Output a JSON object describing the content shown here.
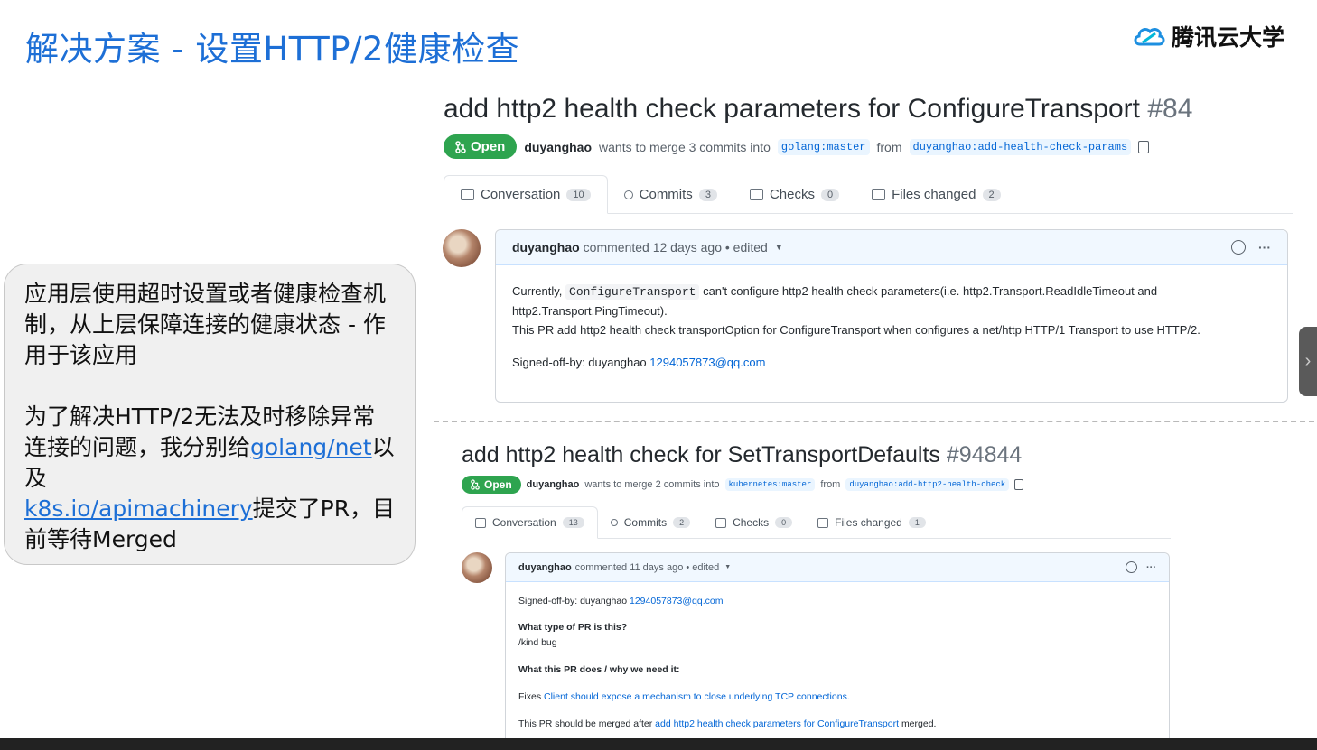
{
  "slide": {
    "title": "解决方案 - 设置HTTP/2健康检查",
    "brand": "腾讯云大学"
  },
  "note": {
    "para1": "应用层使用超时设置或者健康检查机制，从上层保障连接的健康状态 - 作用于该应用",
    "para2_prefix": "为了解决HTTP/2无法及时移除异常连接的问题，我分别给",
    "link1": "golang/net",
    "middle": "以及",
    "link2": "k8s.io/apimachinery",
    "para2_suffix": "提交了PR，目前等待Merged"
  },
  "pr1": {
    "title": "add http2 health check parameters for ConfigureTransport",
    "number": "#84",
    "state": "Open",
    "author": "duyanghao",
    "merge_text": "wants to merge 3 commits into",
    "base": "golang:master",
    "from": "from",
    "head": "duyanghao:add-health-check-params",
    "tabs": [
      {
        "label": "Conversation",
        "count": "10"
      },
      {
        "label": "Commits",
        "count": "3"
      },
      {
        "label": "Checks",
        "count": "0"
      },
      {
        "label": "Files changed",
        "count": "2"
      }
    ],
    "comment": {
      "author": "duyanghao",
      "meta": "commented 12 days ago • edited",
      "line1_prefix": "Currently,",
      "line1_code": "ConfigureTransport",
      "line1_suffix": "can't configure http2 health check parameters(i.e. http2.Transport.ReadIdleTimeout and http2.Transport.PingTimeout).",
      "line2": "This PR add http2 health check transportOption for ConfigureTransport when configures a net/http HTTP/1 Transport to use HTTP/2.",
      "signoff_prefix": "Signed-off-by: duyanghao",
      "signoff_email": "1294057873@qq.com"
    }
  },
  "pr2": {
    "title": "add http2 health check for SetTransportDefaults",
    "number": "#94844",
    "state": "Open",
    "author": "duyanghao",
    "merge_text": "wants to merge 2 commits into",
    "base": "kubernetes:master",
    "from": "from",
    "head": "duyanghao:add-http2-health-check",
    "tabs": [
      {
        "label": "Conversation",
        "count": "13"
      },
      {
        "label": "Commits",
        "count": "2"
      },
      {
        "label": "Checks",
        "count": "0"
      },
      {
        "label": "Files changed",
        "count": "1"
      }
    ],
    "comment": {
      "author": "duyanghao",
      "meta": "commented 11 days ago • edited",
      "signoff_prefix": "Signed-off-by: duyanghao",
      "signoff_email": "1294057873@qq.com",
      "q1": "What type of PR is this?",
      "a1": "/kind bug",
      "q2": "What this PR does / why we need it:",
      "fixes_prefix": "Fixes",
      "fixes_link": "Client should expose a mechanism to close underlying TCP connections.",
      "after_prefix": "This PR should be merged after",
      "after_link": "add http2 health check parameters for ConfigureTransport",
      "after_suffix": "merged."
    }
  },
  "colors": {
    "title_blue": "#1d6fd6",
    "open_green": "#2ea44f",
    "link_blue": "#0366d6"
  }
}
